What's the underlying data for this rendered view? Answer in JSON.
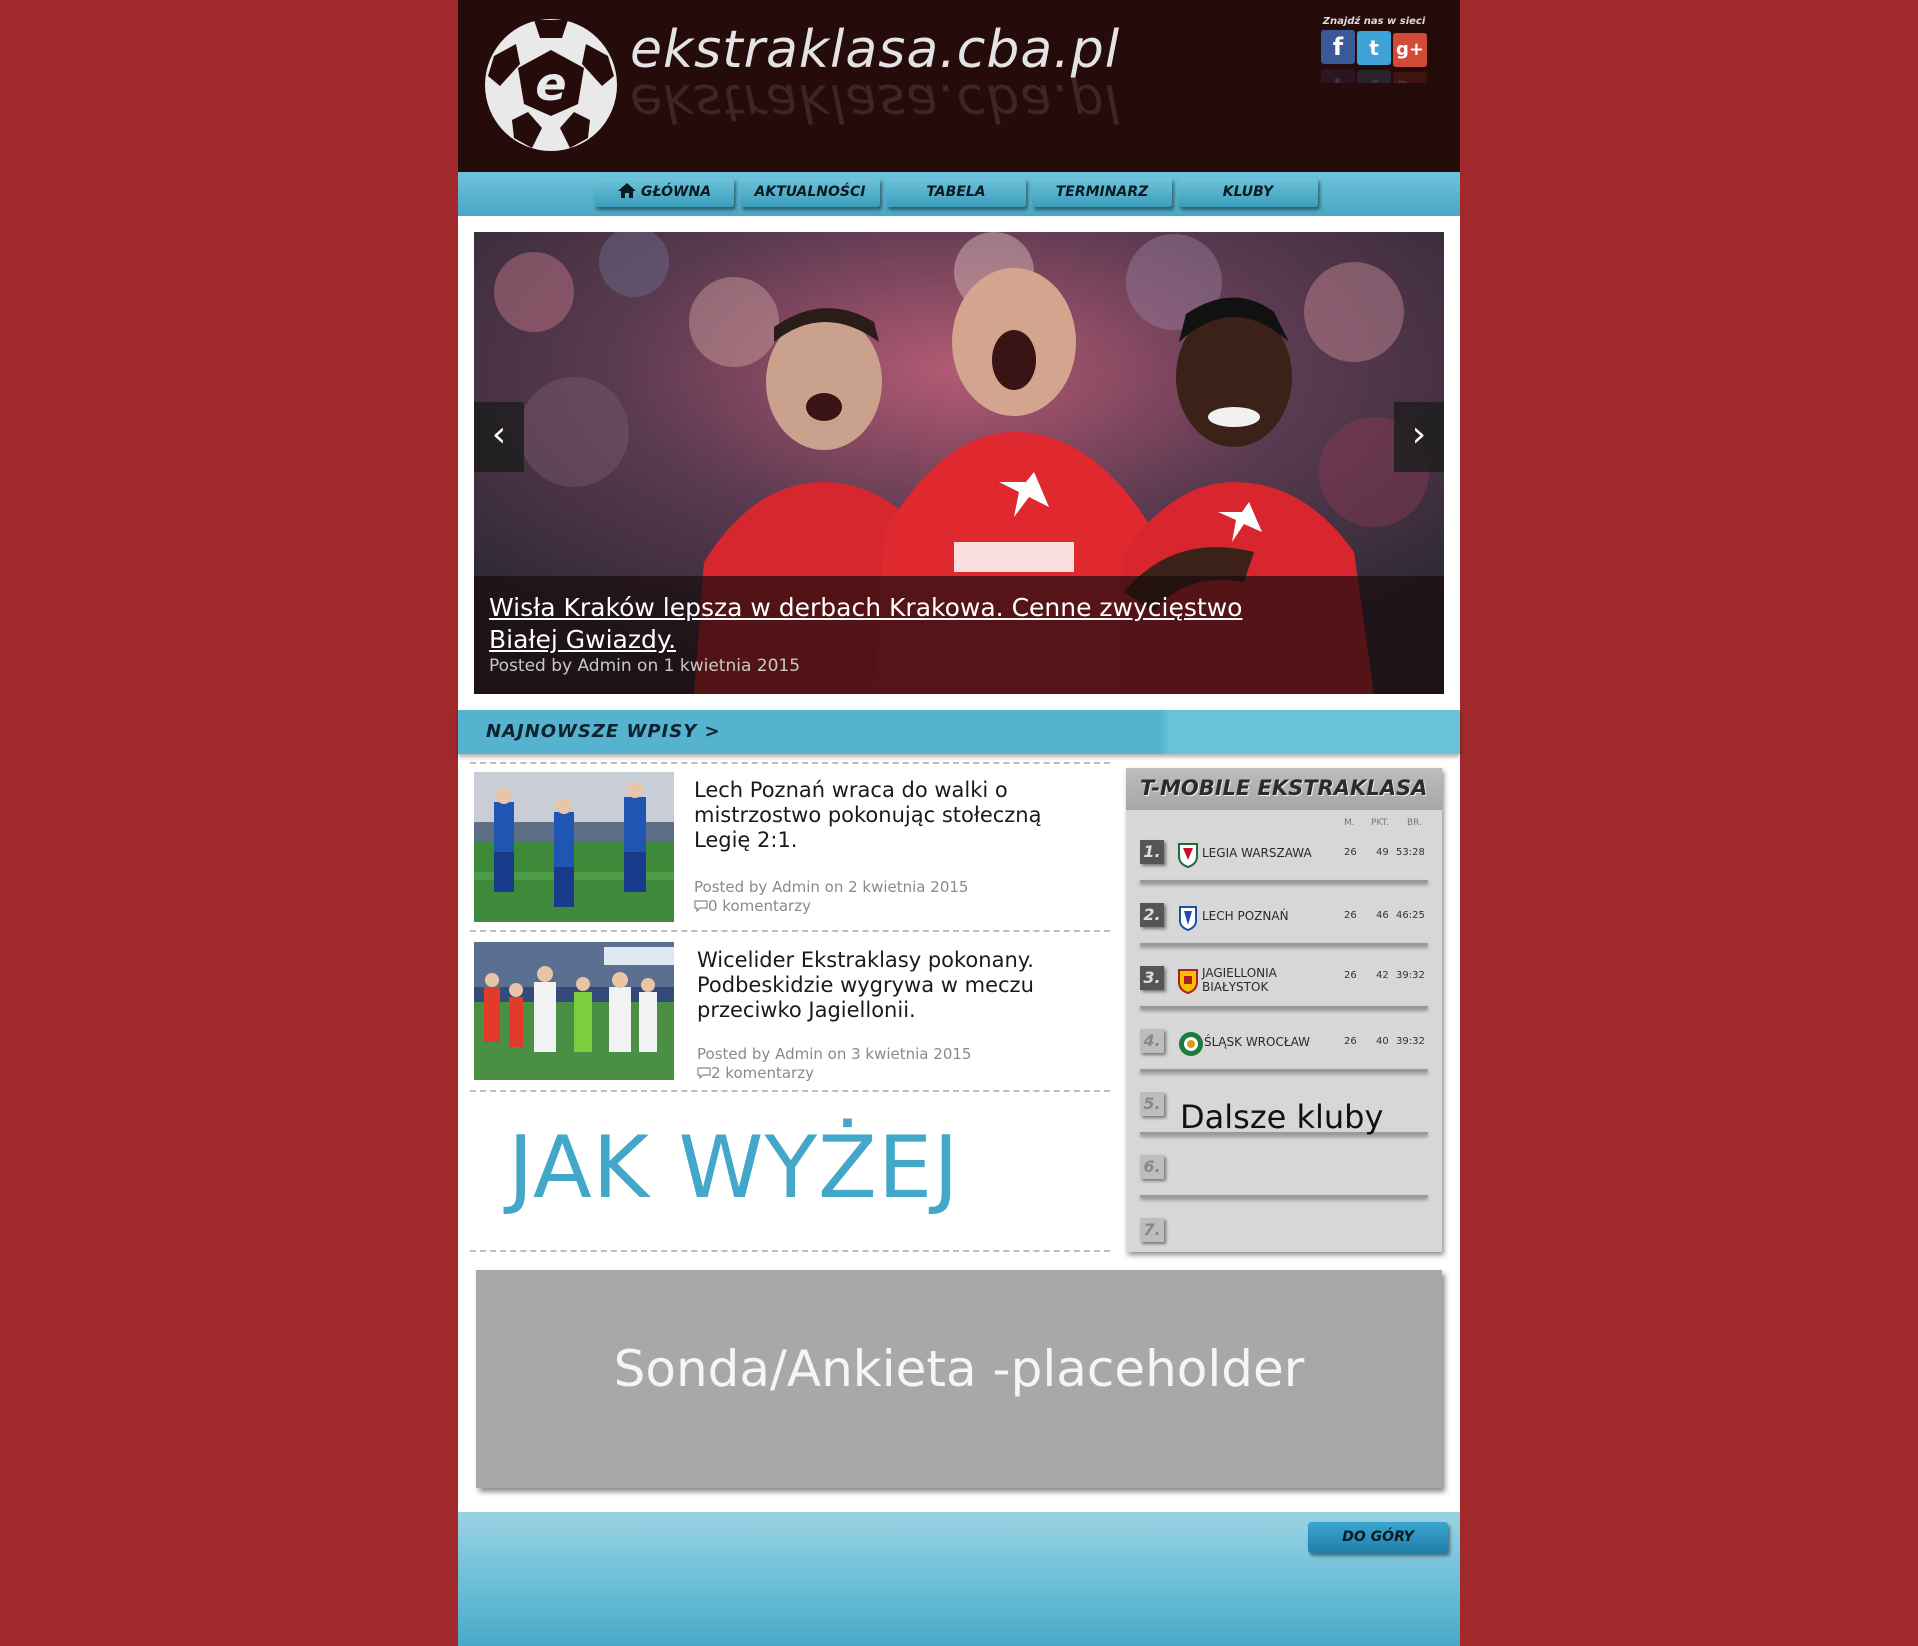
{
  "header": {
    "site_title": "ekstraklasa.cba.pl",
    "social_label": "Znajdź nas w sieci",
    "social": [
      "facebook-icon",
      "twitter-icon",
      "google-plus-icon"
    ]
  },
  "nav": {
    "items": [
      "GŁÓWNA",
      "AKTUALNOŚCI",
      "TABELA",
      "TERMINARZ",
      "KLUBY"
    ]
  },
  "slider": {
    "title": "Wisła Kraków lepsza w derbach Krakowa. Cenne zwycięstwo Białej Gwiazdy.",
    "meta": "Posted by Admin on 1 kwietnia 2015",
    "prev": "‹",
    "next": "›"
  },
  "latest": {
    "label": "NAJNOWSZE WPISY >"
  },
  "posts": [
    {
      "title": "Lech Poznań wraca do walki o mistrzostwo pokonując stołeczną Legię 2:1.",
      "meta": "Posted by Admin on 2 kwietnia 2015",
      "comments": "0 komentarzy"
    },
    {
      "title": "Wicelider Ekstraklasy pokonany. Podbeskidzie wygrywa w meczu przeciwko Jagiellonii.",
      "meta": "Posted by Admin on 3 kwietnia 2015",
      "comments": "2 komentarzy"
    }
  ],
  "placeholder_text": "JAK WYŻEJ",
  "table": {
    "title": "T-MOBILE EKSTRAKLASA",
    "headers": [
      "M.",
      "PKT.",
      "BR."
    ],
    "rows": [
      {
        "rank": "1.",
        "club": "LEGIA WARSZAWA",
        "m": "26",
        "pkt": "49",
        "br": "53:28",
        "crest_color": "#c8102e"
      },
      {
        "rank": "2.",
        "club": "LECH POZNAŃ",
        "m": "26",
        "pkt": "46",
        "br": "46:25",
        "crest_color": "#1d4fa3"
      },
      {
        "rank": "3.",
        "club": "JAGIELLONIA BIAŁYSTOK",
        "m": "26",
        "pkt": "42",
        "br": "39:32",
        "crest_color": "#f2c300"
      },
      {
        "rank": "4.",
        "club": "ŚLĄSK WROCŁAW",
        "m": "26",
        "pkt": "40",
        "br": "39:32",
        "crest_color": "#1c7a3c"
      },
      {
        "rank": "5."
      },
      {
        "rank": "6."
      },
      {
        "rank": "7."
      }
    ],
    "more": "Dalsze kluby"
  },
  "poll": {
    "text": "Sonda/Ankieta -placeholder"
  },
  "footer": {
    "top_button": "DO GÓRY"
  },
  "colors": {
    "page_bg": "#a1292b",
    "header_bg": "#260b0b",
    "accent": "#55b3cf"
  }
}
